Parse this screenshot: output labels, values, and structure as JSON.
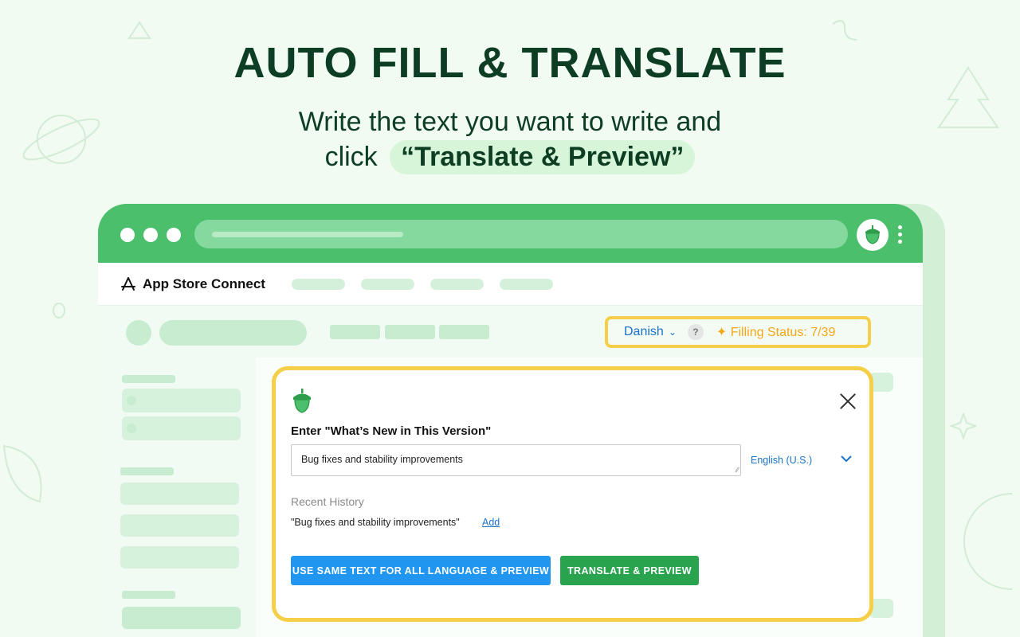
{
  "hero": {
    "title": "AUTO FILL & TRANSLATE",
    "line1": "Write the text you want to write and",
    "line2_prefix": "click",
    "line2_highlight": "“Translate & Preview”"
  },
  "browser": {
    "extension_icon": "acorn-icon",
    "menu_icon": "kebab-menu-icon"
  },
  "appbar": {
    "brand": "App Store Connect",
    "brand_icon": "app-store-icon"
  },
  "status": {
    "language": "Danish",
    "help": "?",
    "filling_status": "✦ Filling Status: 7/39"
  },
  "dialog": {
    "label": "Enter \"What’s New in This Version\"",
    "input_value": "Bug fixes and stability improvements",
    "source_language": "English (U.S.)",
    "history_title": "Recent History",
    "history_item": "\"Bug fixes and stability improvements\"",
    "history_add": "Add",
    "btn_same_text": "USE SAME TEXT FOR ALL LANGUAGE & PREVIEW",
    "btn_translate": "TRANSLATE & PREVIEW"
  },
  "colors": {
    "brand_green": "#4cbf6c",
    "highlight": "#f5cf4a",
    "link_blue": "#1a73c9",
    "primary_blue": "#2196f0",
    "primary_green": "#2aa34f",
    "status_orange": "#f2a81a"
  }
}
